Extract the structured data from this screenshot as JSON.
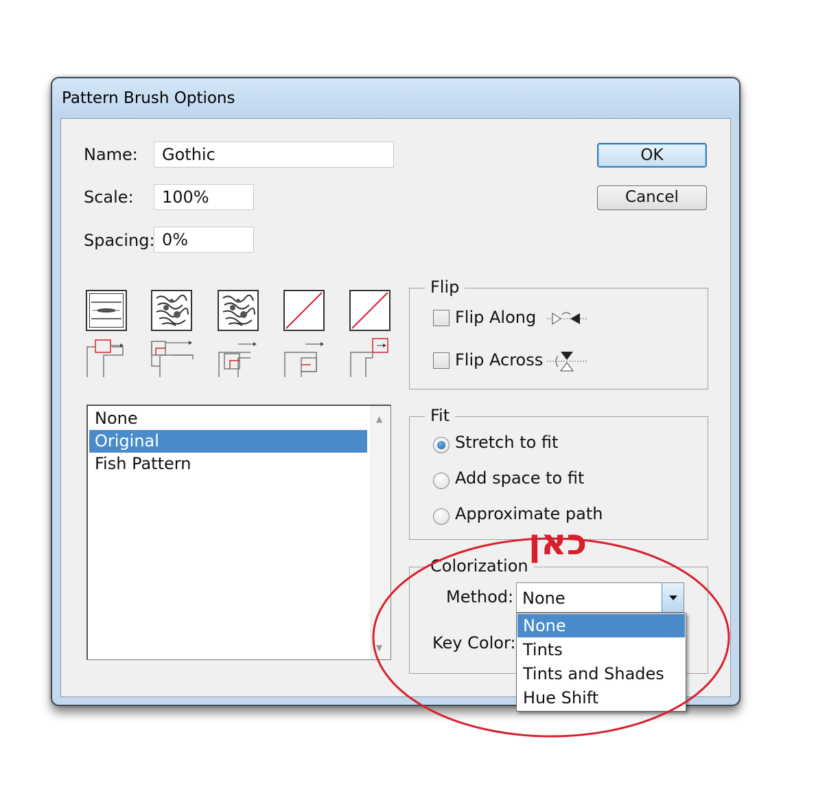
{
  "window": {
    "title": "Pattern Brush Options"
  },
  "fields": {
    "name_label": "Name:",
    "name_value": "Gothic",
    "scale_label": "Scale:",
    "scale_value": "100%",
    "spacing_label": "Spacing:",
    "spacing_value": "0%"
  },
  "buttons": {
    "ok": "OK",
    "cancel": "Cancel"
  },
  "tiles": [
    {
      "name": "side-tile",
      "icon": "side-tile-icon",
      "selected": true
    },
    {
      "name": "outer-corner-tile",
      "icon": "gothic-pattern-icon",
      "selected": false
    },
    {
      "name": "inner-corner-tile",
      "icon": "gothic-pattern-icon",
      "selected": false
    },
    {
      "name": "start-tile",
      "icon": "empty-tile-icon",
      "selected": false
    },
    {
      "name": "end-tile",
      "icon": "empty-tile-icon",
      "selected": false
    }
  ],
  "pattern_list": {
    "items": [
      "None",
      "Original",
      "Fish Pattern"
    ],
    "selected": "Original"
  },
  "flip": {
    "title": "Flip",
    "along_label": "Flip Along",
    "across_label": "Flip Across",
    "along_checked": false,
    "across_checked": false
  },
  "fit": {
    "title": "Fit",
    "options": [
      "Stretch to fit",
      "Add space to fit",
      "Approximate path"
    ],
    "selected": "Stretch to fit"
  },
  "colorization": {
    "title": "Colorization",
    "method_label": "Method:",
    "method_value": "None",
    "key_color_label": "Key Color:",
    "dropdown_options": [
      "None",
      "Tints",
      "Tints and Shades",
      "Hue Shift"
    ],
    "dropdown_highlighted": "None"
  },
  "annotation": {
    "text": "כאן",
    "color": "#d8202b"
  },
  "colors": {
    "selection": "#4a8ccb",
    "annotation_red": "#d8202b",
    "window_frame": "#c4d9ee"
  }
}
